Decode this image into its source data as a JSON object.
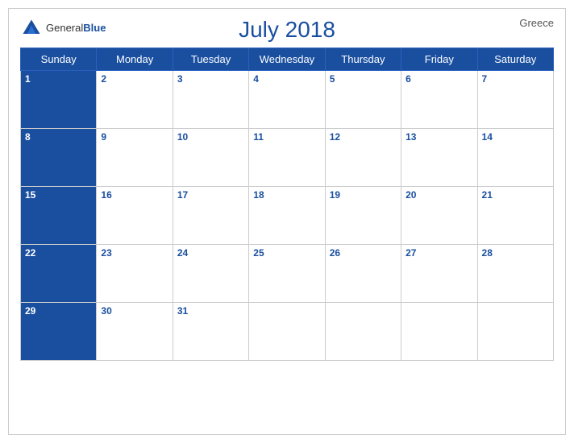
{
  "calendar": {
    "title": "July 2018",
    "country": "Greece",
    "logo": {
      "general": "General",
      "blue": "Blue"
    },
    "days_of_week": [
      "Sunday",
      "Monday",
      "Tuesday",
      "Wednesday",
      "Thursday",
      "Friday",
      "Saturday"
    ],
    "weeks": [
      [
        1,
        2,
        3,
        4,
        5,
        6,
        7
      ],
      [
        8,
        9,
        10,
        11,
        12,
        13,
        14
      ],
      [
        15,
        16,
        17,
        18,
        19,
        20,
        21
      ],
      [
        22,
        23,
        24,
        25,
        26,
        27,
        28
      ],
      [
        29,
        30,
        31,
        null,
        null,
        null,
        null
      ]
    ],
    "accent_color": "#1a4fa0"
  }
}
